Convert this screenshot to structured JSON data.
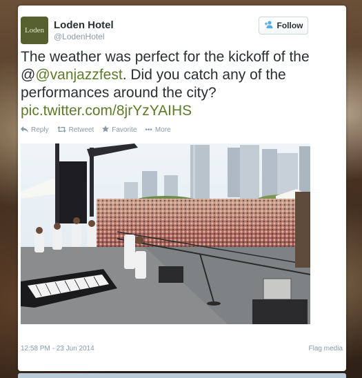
{
  "profile": {
    "name": "Loden Hotel",
    "handle": "@LodenHotel",
    "avatar_text": "Loden"
  },
  "follow": {
    "label": "Follow",
    "icon": "follow-user-icon"
  },
  "tweet": {
    "text_before": "The weather was perfect for the kickoff of the @",
    "mention": "@vanjazzfest",
    "text_after": ". Did you catch any of the performances around the city?",
    "link": "pic.twitter.com/8jrYzYAIHS"
  },
  "actions": {
    "reply": "Reply",
    "retweet": "Retweet",
    "favorite": "Favorite",
    "more": "More"
  },
  "meta": {
    "timestamp": "12:58 PM - 23 Jun 2014",
    "flag": "Flag media"
  },
  "colors": {
    "accent": "#5d7a2a",
    "avatar_bg": "#56602f",
    "muted": "#8899a6"
  }
}
